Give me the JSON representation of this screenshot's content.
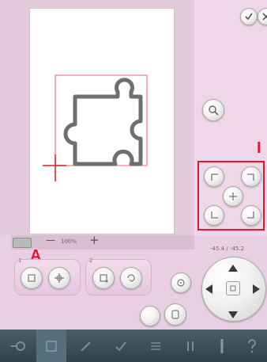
{
  "zoom": {
    "percent_label": "100%",
    "minus_label": "—",
    "plus_label": "+"
  },
  "position_readout": "-45.4 / -45.2",
  "annotations": {
    "label_a": "A",
    "label_i": "I"
  },
  "groups": {
    "group1_number": "1",
    "group2_number": "2"
  },
  "colors": {
    "accent_red": "#e3172e",
    "panel_pink": "#e9cfe3",
    "toolbar": "#3a4e58"
  },
  "icons": {
    "confirm": "check-icon",
    "cancel": "close-icon",
    "zoom": "magnifier-icon",
    "corners": [
      "corner-top-left-icon",
      "corner-top-right-icon",
      "center-icon",
      "corner-bottom-left-icon",
      "corner-bottom-right-icon"
    ],
    "toolbar": [
      "home-icon",
      "layout-icon",
      "pen-icon",
      "check-stitch-icon",
      "list-icon",
      "thread-icon",
      "needle-icon",
      "help-icon"
    ]
  }
}
